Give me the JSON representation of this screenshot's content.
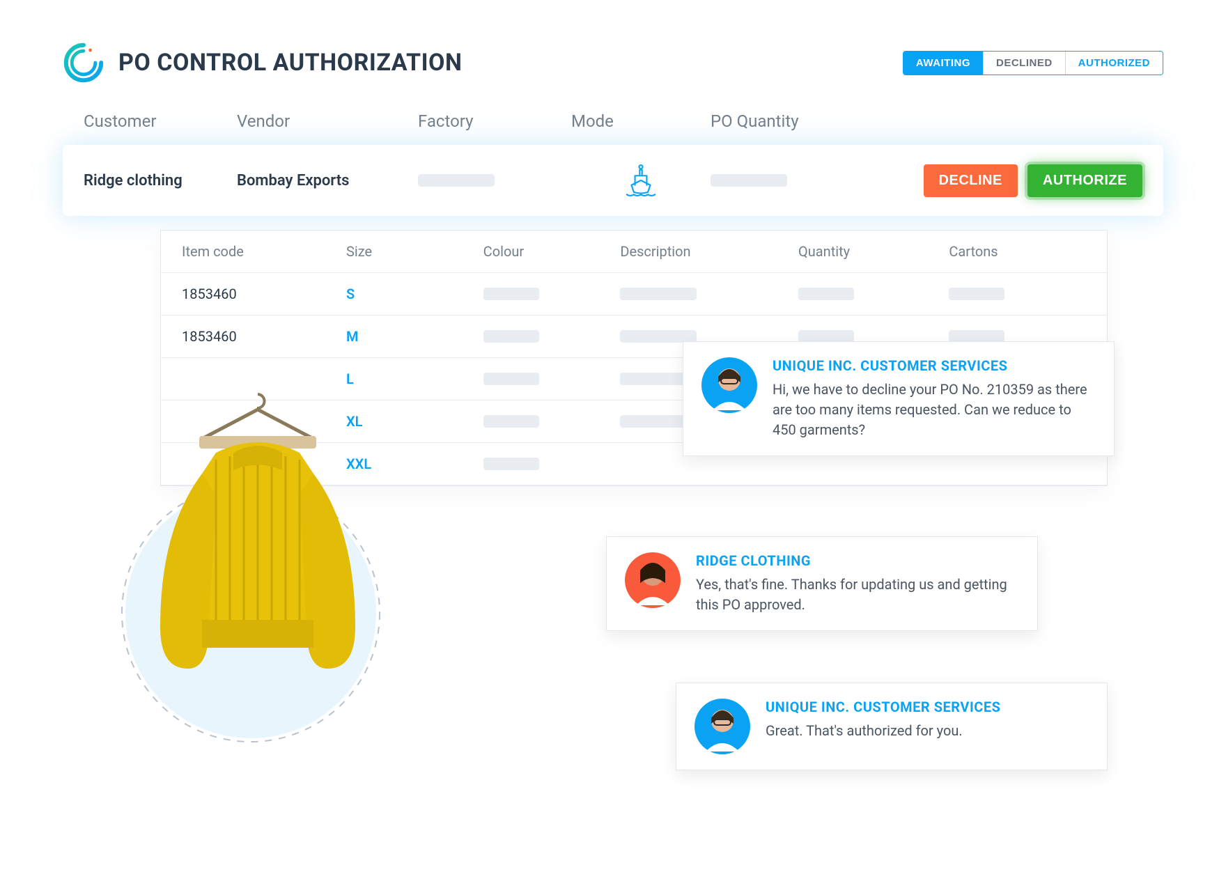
{
  "header": {
    "title": "PO CONTROL AUTHORIZATION"
  },
  "status_filters": {
    "awaiting": "AWAITING",
    "declined": "DECLINED",
    "authorized": "AUTHORIZED"
  },
  "columns": {
    "customer": "Customer",
    "vendor": "Vendor",
    "factory": "Factory",
    "mode": "Mode",
    "po_quantity": "PO Quantity"
  },
  "row": {
    "customer": "Ridge clothing",
    "vendor": "Bombay Exports",
    "decline_label": "DECLINE",
    "authorize_label": "AUTHORIZE"
  },
  "item_columns": {
    "item_code": "Item code",
    "size": "Size",
    "colour": "Colour",
    "description": "Description",
    "quantity": "Quantity",
    "cartons": "Cartons"
  },
  "items": [
    {
      "code": "1853460",
      "size": "S"
    },
    {
      "code": "1853460",
      "size": "M"
    },
    {
      "code": "",
      "size": "L"
    },
    {
      "code": "",
      "size": "XL"
    },
    {
      "code": "",
      "size": "XXL"
    }
  ],
  "chat": [
    {
      "sender": "UNIQUE INC. CUSTOMER SERVICES",
      "message": "Hi, we have to decline your PO No. 210359 as there are too many items requested. Can we reduce to 450 garments?",
      "avatar_bg": "#0aa2f3"
    },
    {
      "sender": "RIDGE CLOTHING",
      "message": "Yes, that's fine. Thanks for updating us and getting this PO approved.",
      "avatar_bg": "#fa5a3c"
    },
    {
      "sender": "UNIQUE INC. CUSTOMER SERVICES",
      "message": "Great. That's authorized for you.",
      "avatar_bg": "#0aa2f3"
    }
  ]
}
